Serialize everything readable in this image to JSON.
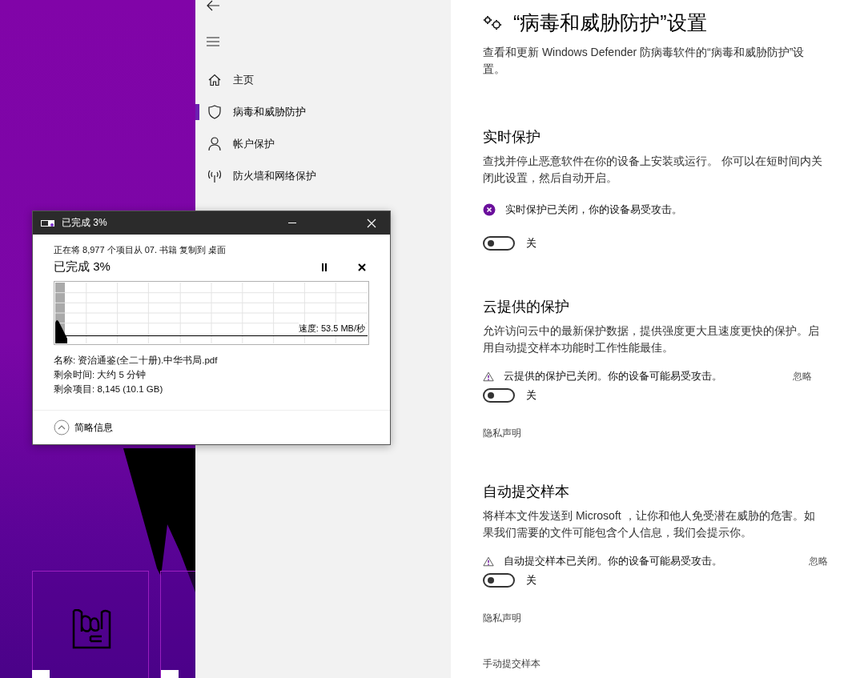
{
  "nav": {
    "items": [
      {
        "label": "主页",
        "selected": false
      },
      {
        "label": "病毒和威胁防护",
        "selected": true
      },
      {
        "label": "帐户保护",
        "selected": false
      },
      {
        "label": "防火墙和网络保护",
        "selected": false
      }
    ]
  },
  "settings": {
    "title": "“病毒和威胁防护”设置",
    "description": "查看和更新 Windows Defender 防病毒软件的“病毒和威胁防护”设置。",
    "sections": [
      {
        "kind": "toggle",
        "heading": "实时保护",
        "description": "查找并停止恶意软件在你的设备上安装或运行。 你可以在短时间内关闭此设置，然后自动开启。",
        "status": {
          "kind": "error",
          "text": "实时保护已关闭，你的设备易受攻击。"
        },
        "toggle": {
          "on": false,
          "label": "关"
        }
      },
      {
        "kind": "toggle",
        "heading": "云提供的保护",
        "description": "允许访问云中的最新保护数据，提供强度更大且速度更快的保护。启用自动提交样本功能时工作性能最佳。",
        "status": {
          "kind": "warning",
          "text": "云提供的保护已关闭。你的设备可能易受攻击。",
          "dismiss": "忽略"
        },
        "toggle": {
          "on": false,
          "label": "关"
        },
        "link": "隐私声明"
      },
      {
        "kind": "toggle",
        "heading": "自动提交样本",
        "description": "将样本文件发送到 Microsoft ，让你和他人免受潜在威胁的危害。如果我们需要的文件可能包含个人信息，我们会提示你。",
        "status": {
          "kind": "warning",
          "text": "自动提交样本已关闭。你的设备可能易受攻击。",
          "dismiss": "忽略"
        },
        "toggle": {
          "on": false,
          "label": "关"
        },
        "link": "隐私声明"
      },
      {
        "kind": "link",
        "heading": "手动提交样本"
      }
    ]
  },
  "copy_dialog": {
    "title": "已完成 3%",
    "summary": "正在将 8,977 个项目从 07. 书籍 复制到 桌面",
    "progress_text": "已完成 3%",
    "level": 0.03,
    "speed": "速度: 53.5 MB/秒",
    "details": [
      "名称: 资治通鉴(全二十册).中华书局.pdf",
      "剩余时间: 大约 5 分钟",
      "剩余项目: 8,145 (10.1 GB)"
    ],
    "toggle_details": "简略信息"
  }
}
